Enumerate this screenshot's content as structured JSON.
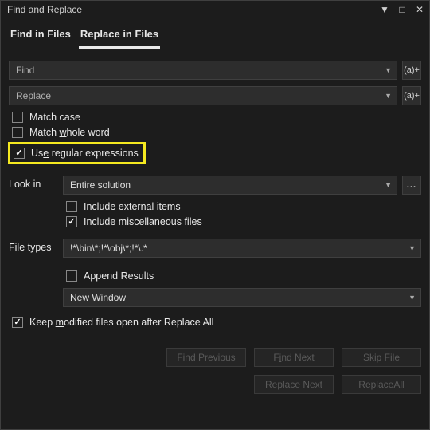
{
  "title": "Find and Replace",
  "tabs": {
    "find": "Find in Files",
    "replace": "Replace in Files"
  },
  "fields": {
    "find_placeholder": "Find",
    "replace_placeholder": "Replace",
    "regex_btn": "(a)+",
    "lookin_label": "Look in",
    "lookin_value": "Entire solution",
    "browse": "...",
    "filetypes_label": "File types",
    "filetypes_value": "!*\\bin\\*;!*\\obj\\*;!*\\.*",
    "resultwin": "New Window"
  },
  "checks": {
    "match_case": "Match case",
    "whole_word_pre": "Match ",
    "whole_word_u": "w",
    "whole_word_post": "hole word",
    "regex_pre": "Us",
    "regex_u": "e",
    "regex_post": " regular expressions",
    "ext_pre": "Include e",
    "ext_u": "x",
    "ext_post": "ternal items",
    "misc": "Include miscellaneous files",
    "append": "Append Results",
    "keep_pre": "Keep ",
    "keep_u": "m",
    "keep_post": "odified files open after Replace All"
  },
  "buttons": {
    "find_prev": "Find Previous",
    "find_next_pre": "F",
    "find_next_u": "i",
    "find_next_post": "nd Next",
    "skip": "Skip File",
    "repl_next_pre": "",
    "repl_next_u": "R",
    "repl_next_post": "eplace Next",
    "repl_all_pre": "Replace ",
    "repl_all_u": "A",
    "repl_all_post": "ll"
  }
}
